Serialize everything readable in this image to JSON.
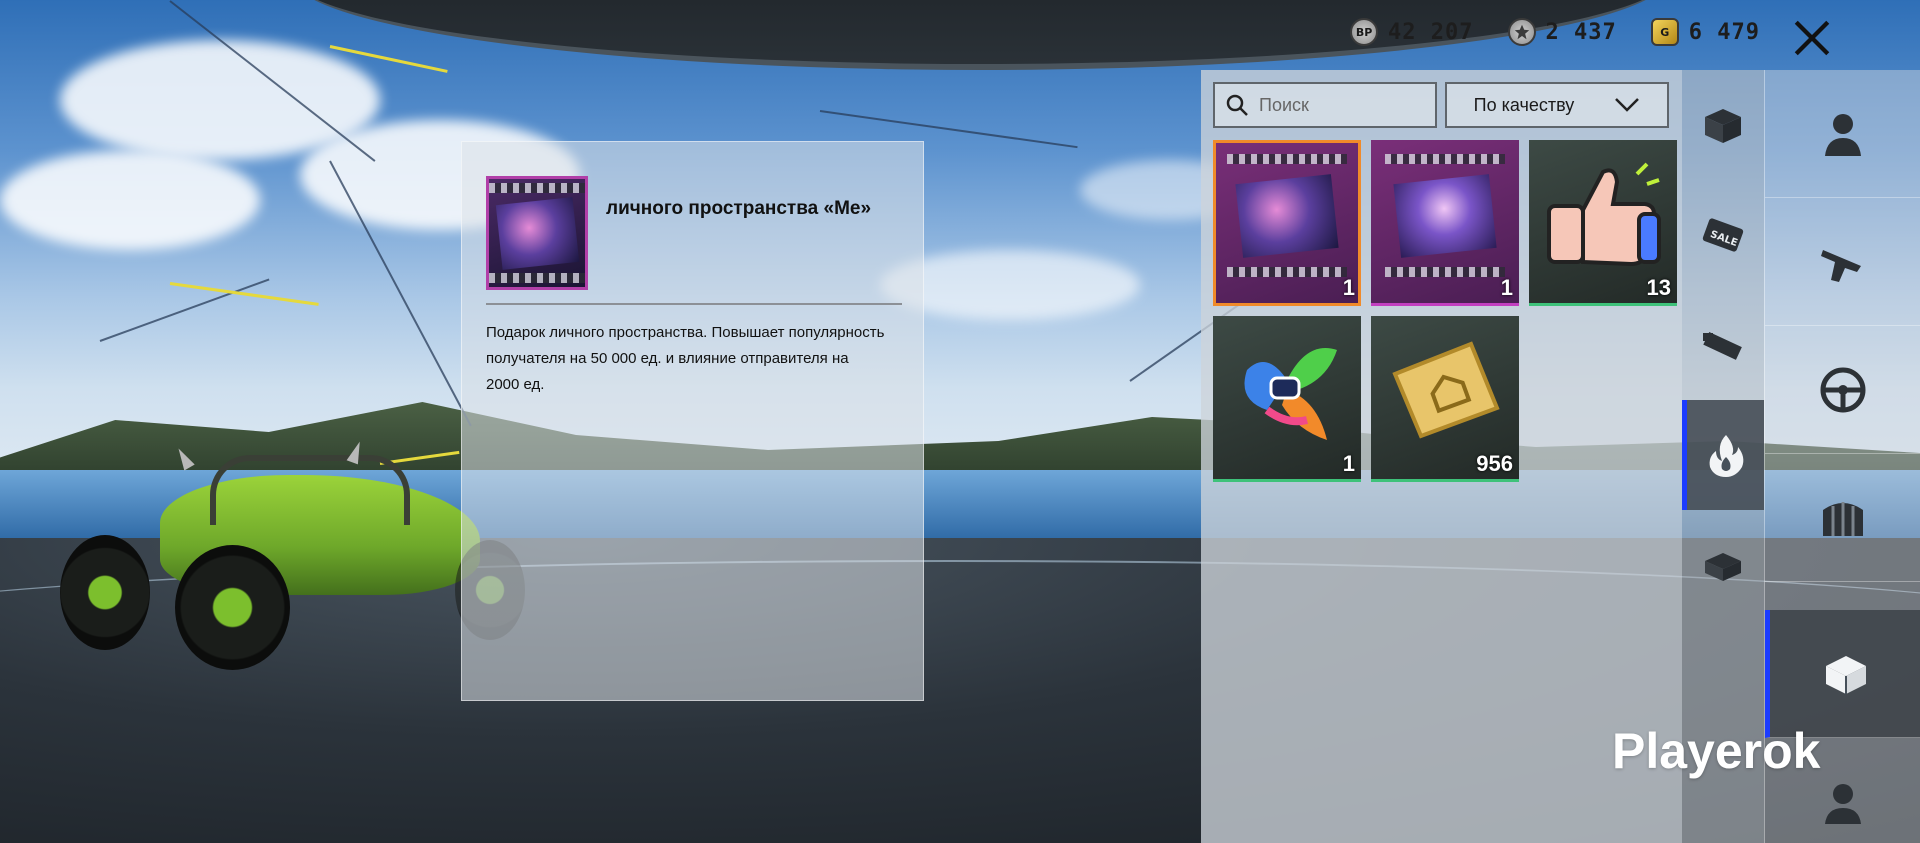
{
  "currencies": [
    {
      "icon": "bp-coin-icon",
      "label": "BP",
      "value": "42 207"
    },
    {
      "icon": "ag-coin-icon",
      "label": "",
      "value": "2 437"
    },
    {
      "icon": "g-coin-icon",
      "label": "G",
      "value": "6 479"
    }
  ],
  "close": {
    "icon": "close-icon"
  },
  "detail": {
    "title": "личного пространства «Me»",
    "description": "Подарок личного пространства. Повышает популярность получателя на 50 000 ед. и влияние отправителя на 2000 ед.",
    "thumbnail_quality": "purple"
  },
  "search": {
    "placeholder": "Поиск",
    "value": ""
  },
  "sort": {
    "label": "По качеству",
    "icon": "chevron-down-icon"
  },
  "items": [
    {
      "name": "space-gift-film-1",
      "count": "1",
      "quality": "purple",
      "selected": true,
      "icon": "film-icon"
    },
    {
      "name": "space-gift-film-2",
      "count": "1",
      "quality": "purple",
      "selected": false,
      "icon": "film-icon"
    },
    {
      "name": "thumbs-up-sticker",
      "count": "13",
      "quality": "green",
      "selected": false,
      "icon": "thumbs-up-icon"
    },
    {
      "name": "rainbow-emblem",
      "count": "1",
      "quality": "green",
      "selected": false,
      "icon": "emblem-icon"
    },
    {
      "name": "space-ticket",
      "count": "956",
      "quality": "green",
      "selected": false,
      "icon": "ticket-icon"
    }
  ],
  "categories": [
    {
      "name": "crate-icon",
      "active": false
    },
    {
      "name": "sale-icon",
      "active": false
    },
    {
      "name": "ammo-icon",
      "active": false
    },
    {
      "name": "fire-icon",
      "active": true
    },
    {
      "name": "box-icon",
      "active": false
    }
  ],
  "subcategories": [
    {
      "name": "character-icon",
      "active": false
    },
    {
      "name": "pistol-icon",
      "active": false
    },
    {
      "name": "steering-wheel-icon",
      "active": false
    },
    {
      "name": "barricade-icon",
      "active": false
    },
    {
      "name": "package-icon",
      "active": true
    },
    {
      "name": "avatar-icon",
      "active": false
    }
  ],
  "watermark": "Playerok",
  "colors": {
    "accent": "#1c3cff",
    "purple_quality": "#c23fc0",
    "green_quality": "#3ec27a",
    "selected": "#f08a2a"
  }
}
